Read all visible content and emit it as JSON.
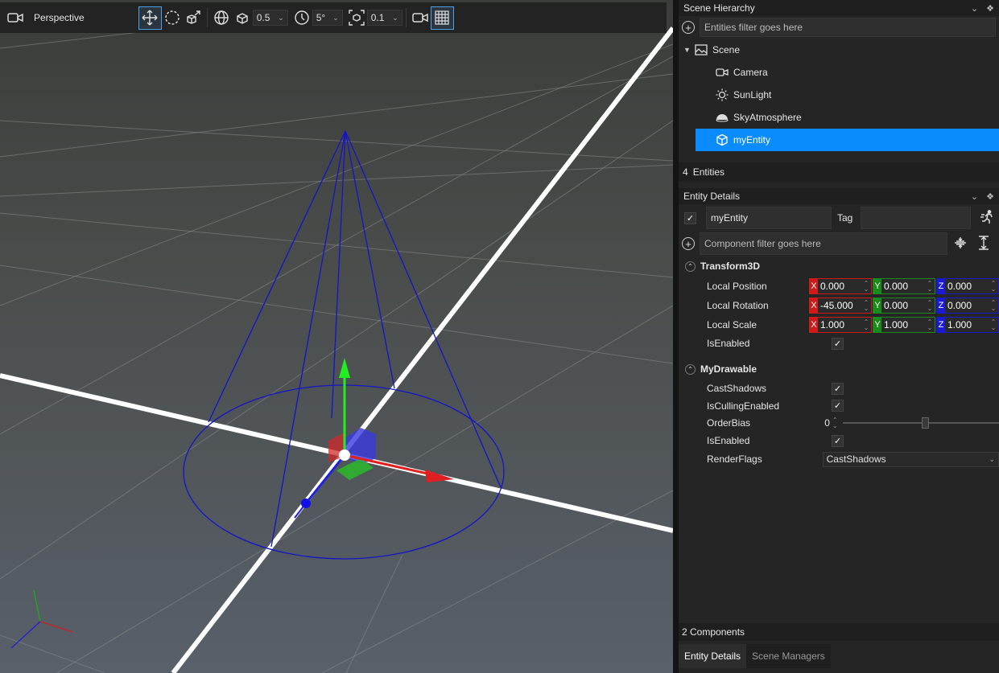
{
  "viewport": {
    "label": "Perspective",
    "dd_snap": "0.5",
    "dd_angle": "5°",
    "dd_scale": "0.1"
  },
  "hierarchy": {
    "title": "Scene Hierarchy",
    "filter_placeholder": "Entities filter goes here",
    "root": "Scene",
    "children": [
      "Camera",
      "SunLight",
      "SkyAtmosphere",
      "myEntity"
    ],
    "count_number": "4",
    "count_label": "Entities"
  },
  "details": {
    "title": "Entity Details",
    "entity_name": "myEntity",
    "tag_label": "Tag",
    "tag_value": "",
    "component_filter_placeholder": "Component filter goes here",
    "transform": {
      "title": "Transform3D",
      "local_position": {
        "label": "Local Position",
        "x": "0.000",
        "y": "0.000",
        "z": "0.000"
      },
      "local_rotation": {
        "label": "Local Rotation",
        "x": "-45.000",
        "y": "0.000",
        "z": "0.000"
      },
      "local_scale": {
        "label": "Local Scale",
        "x": "1.000",
        "y": "1.000",
        "z": "1.000"
      },
      "is_enabled_label": "IsEnabled"
    },
    "drawable": {
      "title": "MyDrawable",
      "cast_shadows_label": "CastShadows",
      "culling_label": "IsCullingEnabled",
      "order_bias_label": "OrderBias",
      "order_bias_value": "0",
      "is_enabled_label": "IsEnabled",
      "render_flags_label": "RenderFlags",
      "render_flags_value": "CastShadows"
    },
    "components_count": "2 Components"
  },
  "tabs": [
    "Entity Details",
    "Scene Managers"
  ],
  "axis_letters": {
    "x": "X",
    "y": "Y",
    "z": "Z"
  },
  "colors": {
    "selection": "#0a8cff",
    "axis_x": "#d01a1a",
    "axis_y": "#1a8a1a",
    "axis_z": "#1a1ad0"
  }
}
